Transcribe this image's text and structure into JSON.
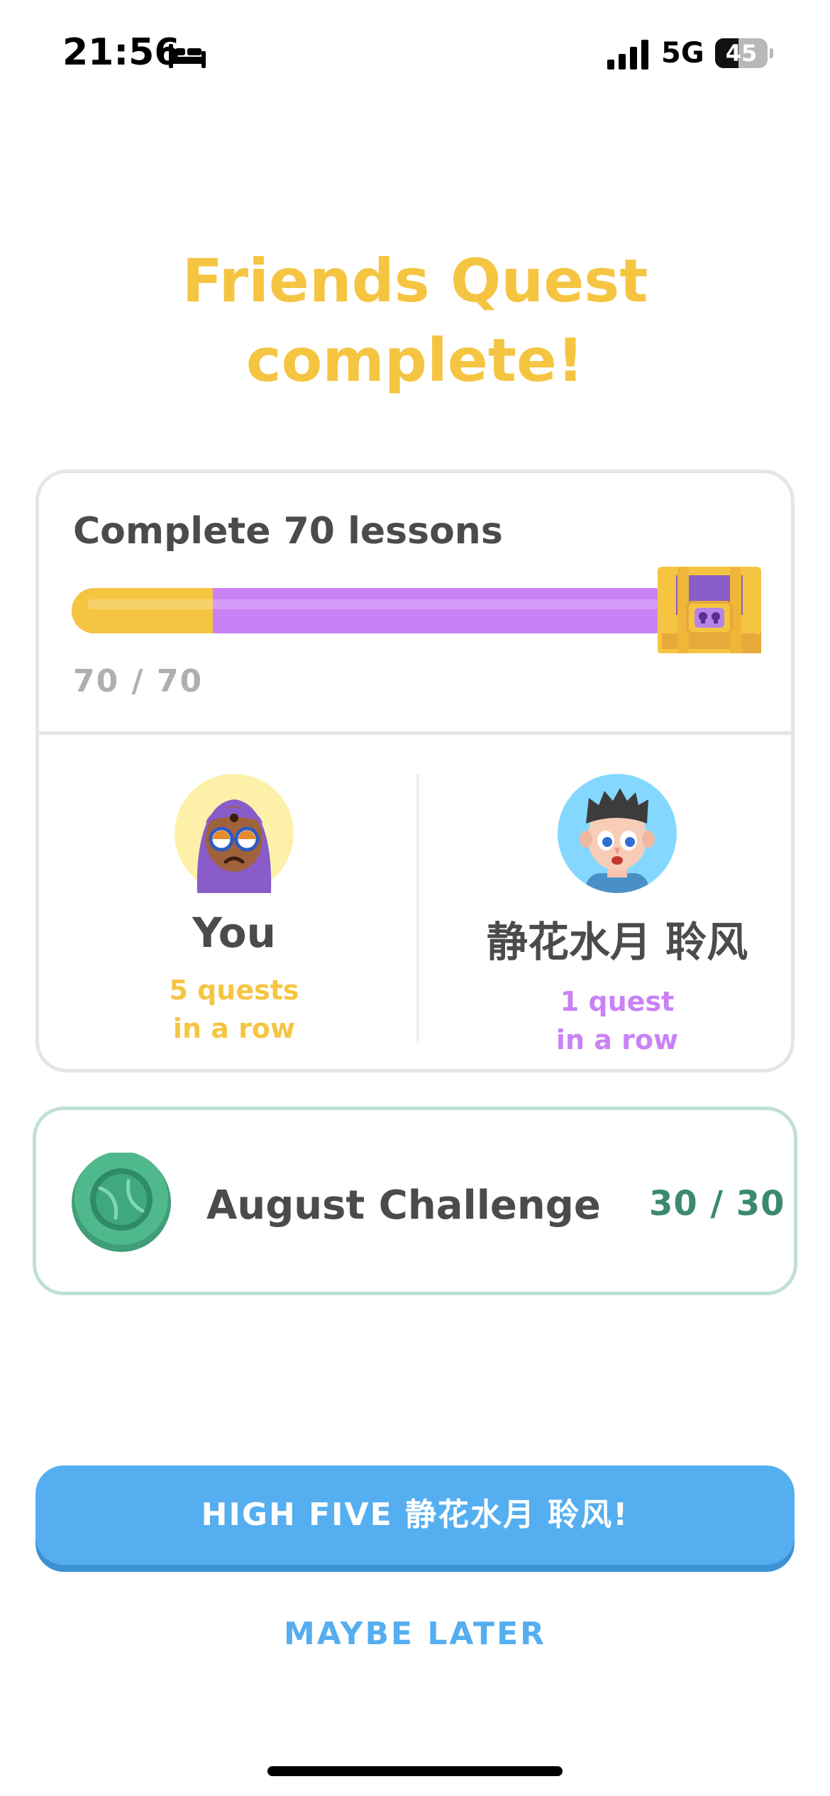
{
  "status_bar": {
    "time": "21:56",
    "network": "5G",
    "battery_percent": "45",
    "icons": [
      "bed-icon",
      "signal-icon",
      "battery-icon"
    ]
  },
  "title": {
    "line1": "Friends Quest",
    "line2": "complete!"
  },
  "quest": {
    "goal_label": "Complete 70 lessons",
    "count_text": "70 / 70",
    "progress": {
      "you_fraction": 0.234,
      "total_fraction": 1.0
    },
    "reward_icon": "treasure-chest-icon",
    "members": [
      {
        "name": "You",
        "streak_line1": "5 quests",
        "streak_line2": "in a row",
        "avatar_icon": "avatar-hijab-glasses-icon"
      },
      {
        "name": "静花水月 聆风",
        "streak_line1": "1 quest",
        "streak_line2": "in a row",
        "avatar_icon": "avatar-boy-icon"
      }
    ]
  },
  "challenge": {
    "name": "August Challenge",
    "count_text": "30 / 30",
    "badge_icon": "tennis-ball-badge-icon"
  },
  "buttons": {
    "primary_label": "HIGH FIVE 静花水月 聆风!",
    "secondary_label": "MAYBE LATER"
  },
  "colors": {
    "title": "#f5c542",
    "you_progress": "#f5c542",
    "friend_progress": "#c982f6",
    "primary_button": "#55aef0",
    "challenge_border": "#bfe0d6",
    "challenge_count": "#3a8a6b"
  }
}
